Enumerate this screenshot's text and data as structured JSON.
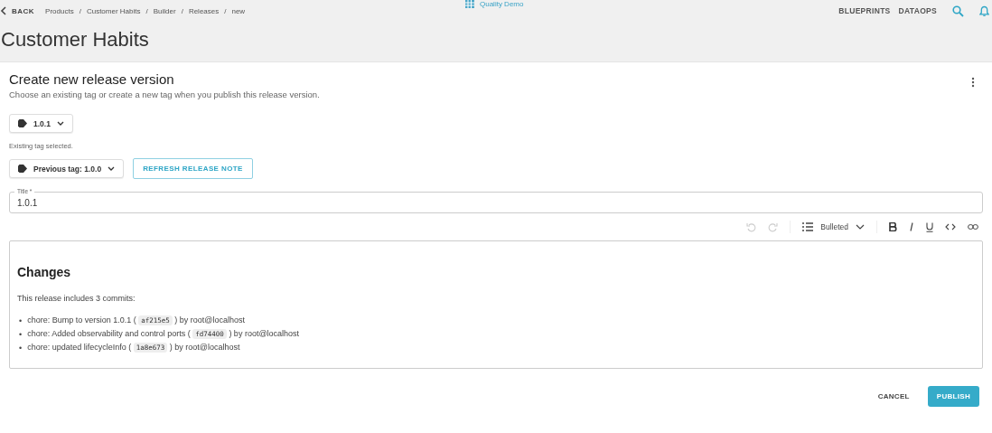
{
  "top_bar": {
    "back": "BACK",
    "breadcrumbs": [
      "Products",
      "Customer Habits",
      "Builder",
      "Releases",
      "new"
    ],
    "separator": "/",
    "workspace": "Quality Demo",
    "nav": [
      "BLUEPRINTS",
      "DATAOPS"
    ]
  },
  "page_title": "Customer Habits",
  "form": {
    "heading": "Create new release version",
    "subheading": "Choose an existing tag or create a new tag when you publish this release version.",
    "tag": "1.0.1",
    "tag_hint": "Existing tag selected.",
    "previous_tag": "Previous tag: 1.0.0",
    "refresh": "REFRESH RELEASE NOTE",
    "title_label": "Title *",
    "title_value": "1.0.1",
    "toolbar": {
      "list_style": "Bulleted",
      "undo_disabled": true,
      "redo_disabled": true
    },
    "editor": {
      "bullet": "•",
      "heading": "Changes",
      "intro": "This release includes 3 commits:",
      "commits": [
        {
          "before": "chore: Bump to version 1.0.1 (",
          "hash": "af215e5",
          "after": ") by root@localhost"
        },
        {
          "before": "chore: Added observability and control ports (",
          "hash": "fd74400",
          "after": ") by root@localhost"
        },
        {
          "before": "chore: updated lifecycleInfo (",
          "hash": "1a8e673",
          "after": ") by root@localhost"
        }
      ]
    },
    "buttons": {
      "cancel": "CANCEL",
      "publish": "PUBLISH"
    }
  }
}
